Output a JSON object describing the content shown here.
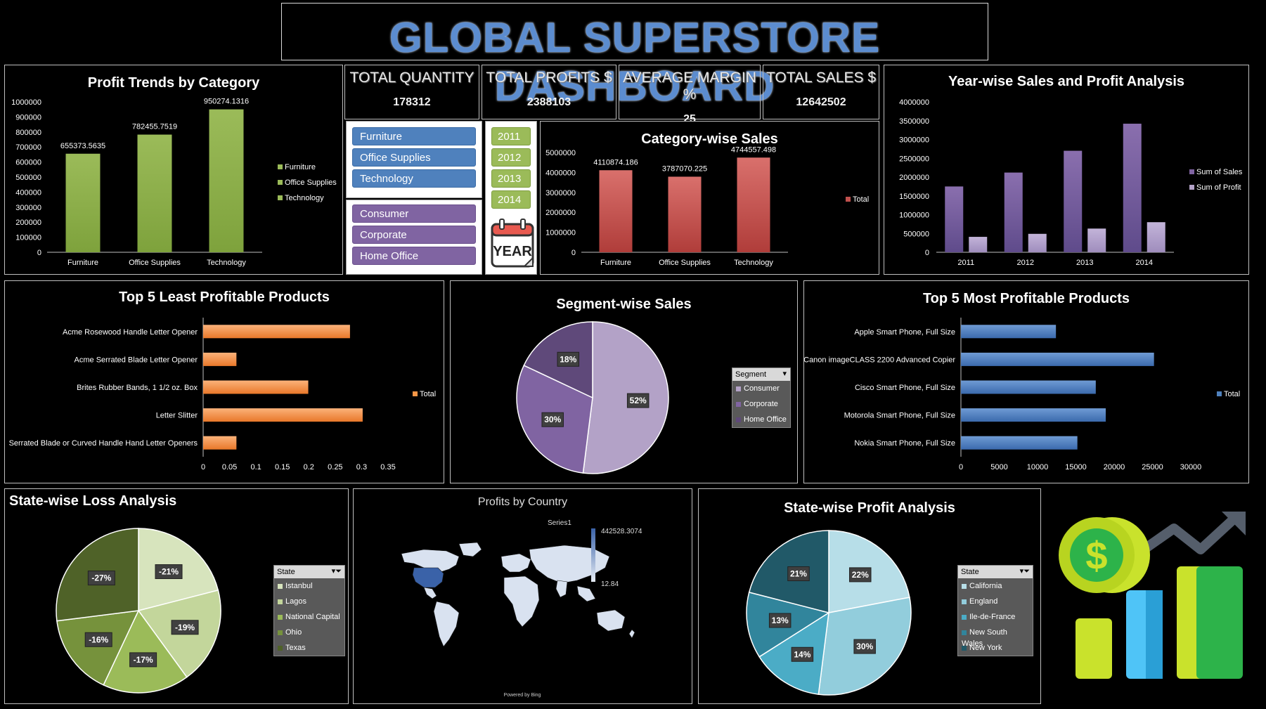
{
  "header": {
    "title": "GLOBAL SUPERSTORE DASHBOARD"
  },
  "kpis": [
    {
      "label": "TOTAL QUANTITY",
      "value": "178312"
    },
    {
      "label": "TOTAL PROFITS $",
      "value": "2388103"
    },
    {
      "label": "AVERAGE MARGIN %",
      "value": "25"
    },
    {
      "label": "TOTAL SALES $",
      "value": "12642502"
    }
  ],
  "slicers": {
    "category": [
      "Furniture",
      "Office Supplies",
      "Technology"
    ],
    "segment": [
      "Consumer",
      "Corporate",
      "Home Office"
    ],
    "year": [
      "2011",
      "2012",
      "2013",
      "2014"
    ],
    "year_icon_text": "YEAR"
  },
  "colors": {
    "green": "#9bbb59",
    "red": "#c0504d",
    "purple": "#8064a2",
    "light_purple": "#b3a2c7",
    "orange": "#f79646",
    "blue": "#4f81bd"
  },
  "chart_data": [
    {
      "id": "profit_trends",
      "type": "bar",
      "title": "Profit Trends by Category",
      "categories": [
        "Furniture",
        "Office Supplies",
        "Technology"
      ],
      "values": [
        655373.5635,
        782455.7519,
        950274.1316
      ],
      "data_labels": [
        "655373.5635",
        "782455.7519",
        "950274.1316"
      ],
      "ylim": [
        0,
        1000000
      ],
      "yticks": [
        "0",
        "100000",
        "200000",
        "300000",
        "400000",
        "500000",
        "600000",
        "700000",
        "800000",
        "900000",
        "1000000"
      ],
      "legend": [
        "Furniture",
        "Office Supplies",
        "Technology"
      ],
      "legend_position": "right"
    },
    {
      "id": "category_sales",
      "type": "bar",
      "title": "Category-wise Sales",
      "categories": [
        "Furniture",
        "Office Supplies",
        "Technology"
      ],
      "values": [
        4110874.186,
        3787070.225,
        4744557.498
      ],
      "data_labels": [
        "4110874.186",
        "3787070.225",
        "4744557.498"
      ],
      "ylim": [
        0,
        5000000
      ],
      "yticks": [
        "0",
        "1000000",
        "2000000",
        "3000000",
        "4000000",
        "5000000"
      ],
      "legend": [
        "Total"
      ],
      "legend_position": "right"
    },
    {
      "id": "year_sales_profit",
      "type": "bar",
      "title": "Year-wise Sales and Profit Analysis",
      "categories": [
        "2011",
        "2012",
        "2013",
        "2014"
      ],
      "series": [
        {
          "name": "Sum of Sales",
          "values": [
            1750000,
            2120000,
            2700000,
            3420000
          ]
        },
        {
          "name": "Sum of Profit",
          "values": [
            410000,
            490000,
            630000,
            800000
          ]
        }
      ],
      "ylim": [
        0,
        4000000
      ],
      "yticks": [
        "0",
        "500000",
        "1000000",
        "1500000",
        "2000000",
        "2500000",
        "3000000",
        "3500000",
        "4000000"
      ],
      "legend_position": "right"
    },
    {
      "id": "least_profitable",
      "type": "bar",
      "orientation": "horizontal",
      "title": "Top 5 Least Profitable Products",
      "categories": [
        "Acme Rosewood Handle Letter Opener",
        "Acme Serrated Blade Letter Opener",
        "Brites Rubber Bands, 1 1/2 oz. Box",
        "Letter Slitter",
        "Serrated Blade or Curved Handle Hand Letter Openers"
      ],
      "values": [
        0.278,
        0.063,
        0.199,
        0.302,
        0.063
      ],
      "xlim": [
        0,
        0.35
      ],
      "xticks": [
        "0",
        "0.05",
        "0.1",
        "0.15",
        "0.2",
        "0.25",
        "0.3",
        "0.35"
      ],
      "legend": [
        "Total"
      ],
      "legend_position": "right"
    },
    {
      "id": "segment_sales",
      "type": "pie",
      "title": "Segment-wise Sales",
      "categories": [
        "Consumer",
        "Corporate",
        "Home Office"
      ],
      "values": [
        52,
        30,
        18
      ],
      "data_labels": [
        "52%",
        "30%",
        "18%"
      ],
      "legend_title": "Segment",
      "legend_position": "right"
    },
    {
      "id": "most_profitable",
      "type": "bar",
      "orientation": "horizontal",
      "title": "Top 5 Most Profitable Products",
      "categories": [
        "Apple Smart Phone, Full Size",
        "Canon imageCLASS 2200 Advanced Copier",
        "Cisco Smart Phone, Full Size",
        "Motorola Smart Phone, Full Size",
        "Nokia Smart Phone, Full Size"
      ],
      "values": [
        12400,
        25200,
        17600,
        18900,
        15200
      ],
      "xlim": [
        0,
        30000
      ],
      "xticks": [
        "0",
        "5000",
        "10000",
        "15000",
        "20000",
        "25000",
        "30000"
      ],
      "legend": [
        "Total"
      ],
      "legend_position": "right"
    },
    {
      "id": "state_loss",
      "type": "pie",
      "title": "State-wise Loss Analysis",
      "categories": [
        "Istanbul",
        "Lagos",
        "National Capital",
        "Ohio",
        "Texas"
      ],
      "values": [
        21,
        19,
        17,
        16,
        27
      ],
      "data_labels": [
        "-21%",
        "-19%",
        "-17%",
        "-16%",
        "-27%"
      ],
      "legend_title": "State",
      "legend_position": "right"
    },
    {
      "id": "profit_country",
      "type": "heatmap",
      "title": "Profits by Country",
      "legend_title": "Series1",
      "range": [
        "442528.3074",
        "12.84"
      ],
      "footer": "Powered by Bing"
    },
    {
      "id": "state_profit",
      "type": "pie",
      "title": "State-wise Profit Analysis",
      "categories": [
        "California",
        "England",
        "Ile-de-France",
        "New South Wales",
        "New York"
      ],
      "values": [
        22,
        30,
        14,
        13,
        21
      ],
      "data_labels": [
        "22%",
        "30%",
        "14%",
        "13%",
        "21%"
      ],
      "legend_title": "State",
      "legend_position": "right"
    }
  ]
}
